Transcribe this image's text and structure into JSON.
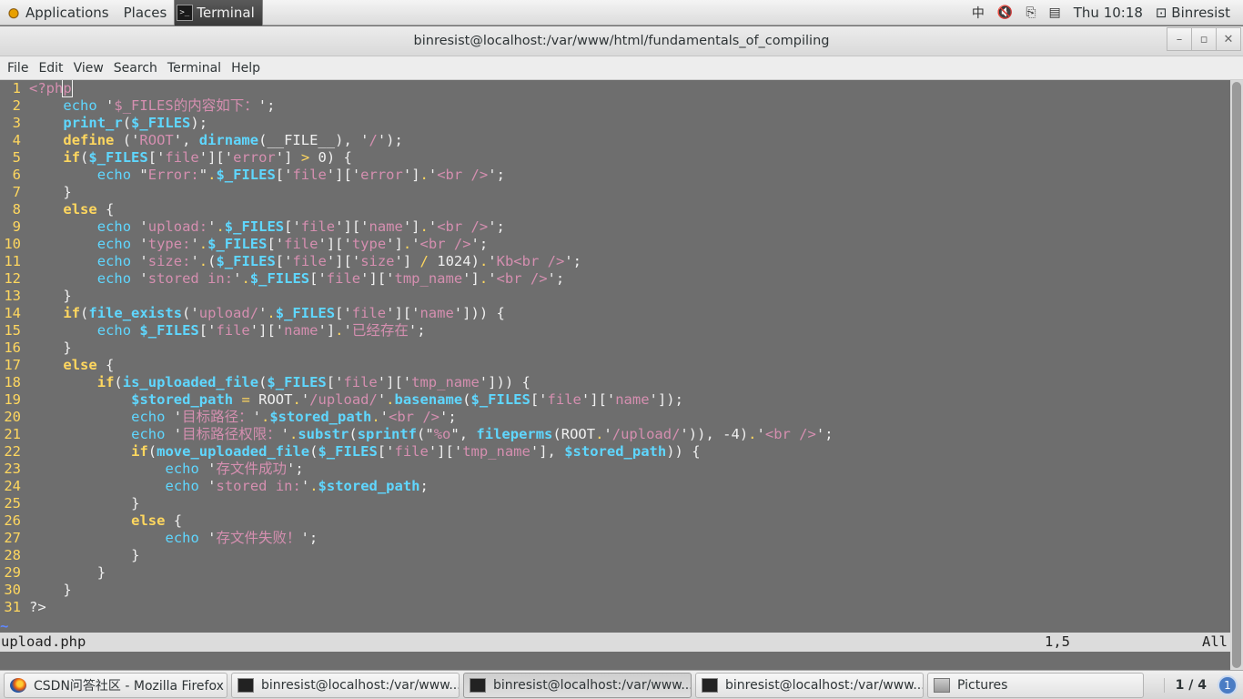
{
  "top_panel": {
    "applications": "Applications",
    "places": "Places",
    "active_task": "Terminal",
    "input_method": "中",
    "clock": "Thu 10:18",
    "user": "Binresist"
  },
  "window": {
    "title": "binresist@localhost:/var/www/html/fundamentals_of_compiling",
    "menu": [
      "File",
      "Edit",
      "View",
      "Search",
      "Terminal",
      "Help"
    ]
  },
  "editor": {
    "filename": "upload.php",
    "cursor_position": "1,5",
    "scroll_indicator": "All",
    "tilde": "~",
    "lines": [
      "<?php",
      "    echo '$_FILES的内容如下：';",
      "    print_r($_FILES);",
      "    define ('ROOT', dirname(__FILE__), '/');",
      "    if($_FILES['file']['error'] > 0) {",
      "        echo \"Error:\".$_FILES['file']['error'].'<br />';",
      "    }",
      "    else {",
      "        echo 'upload:'.$_FILES['file']['name'].'<br />';",
      "        echo 'type:'.$_FILES['file']['type'].'<br />';",
      "        echo 'size:'.($_FILES['file']['size'] / 1024).'Kb<br />';",
      "        echo 'stored in:'.$_FILES['file']['tmp_name'].'<br />';",
      "    }",
      "    if(file_exists('upload/'.$_FILES['file']['name'])) {",
      "        echo $_FILES['file']['name'].'已经存在';",
      "    }",
      "    else {",
      "        if(is_uploaded_file($_FILES['file']['tmp_name'])) {",
      "            $stored_path = ROOT.'/upload/'.basename($_FILES['file']['name']);",
      "            echo '目标路径：'.$stored_path.'<br />';",
      "            echo '目标路径权限：'.substr(sprintf(\"%o\", fileperms(ROOT.'/upload/')), -4).'<br />';",
      "            if(move_uploaded_file($_FILES['file']['tmp_name'], $stored_path)) {",
      "                echo '存文件成功';",
      "                echo 'stored in:'.$stored_path;",
      "            }",
      "            else {",
      "                echo '存文件失败！';",
      "            }",
      "        }",
      "    }",
      "?>"
    ]
  },
  "taskbar": {
    "tasks": [
      "CSDN问答社区 - Mozilla Firefox",
      "binresist@localhost:/var/www...",
      "binresist@localhost:/var/www...",
      "binresist@localhost:/var/www...",
      "Pictures"
    ],
    "workspace": "1 / 4",
    "notifications": "1"
  }
}
